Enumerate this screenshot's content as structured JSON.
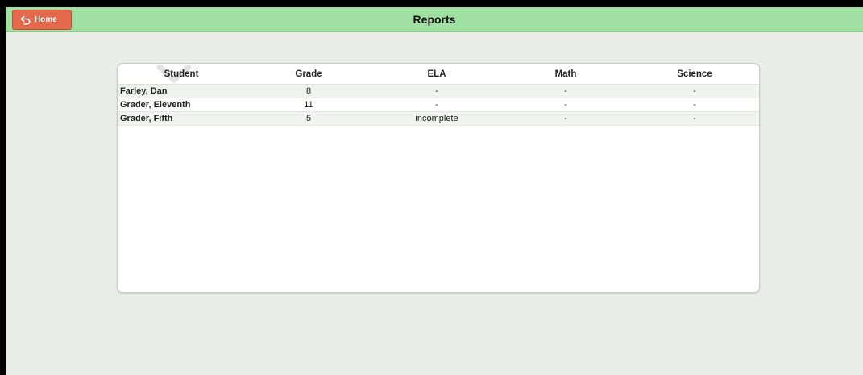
{
  "header": {
    "title": "Reports",
    "home_label": "Home",
    "home_icon": "undo-arrow-icon",
    "bar_color": "#a1e0a3",
    "button_color": "#e5694d"
  },
  "table": {
    "columns": [
      "Student",
      "Grade",
      "ELA",
      "Math",
      "Science"
    ],
    "rows": [
      {
        "student": "Farley, Dan",
        "grade": "8",
        "ela": "-",
        "math": "-",
        "science": "-"
      },
      {
        "student": "Grader, Eleventh",
        "grade": "11",
        "ela": "-",
        "math": "-",
        "science": "-"
      },
      {
        "student": "Grader, Fifth",
        "grade": "5",
        "ela": "incomplete",
        "math": "-",
        "science": "-"
      }
    ]
  }
}
